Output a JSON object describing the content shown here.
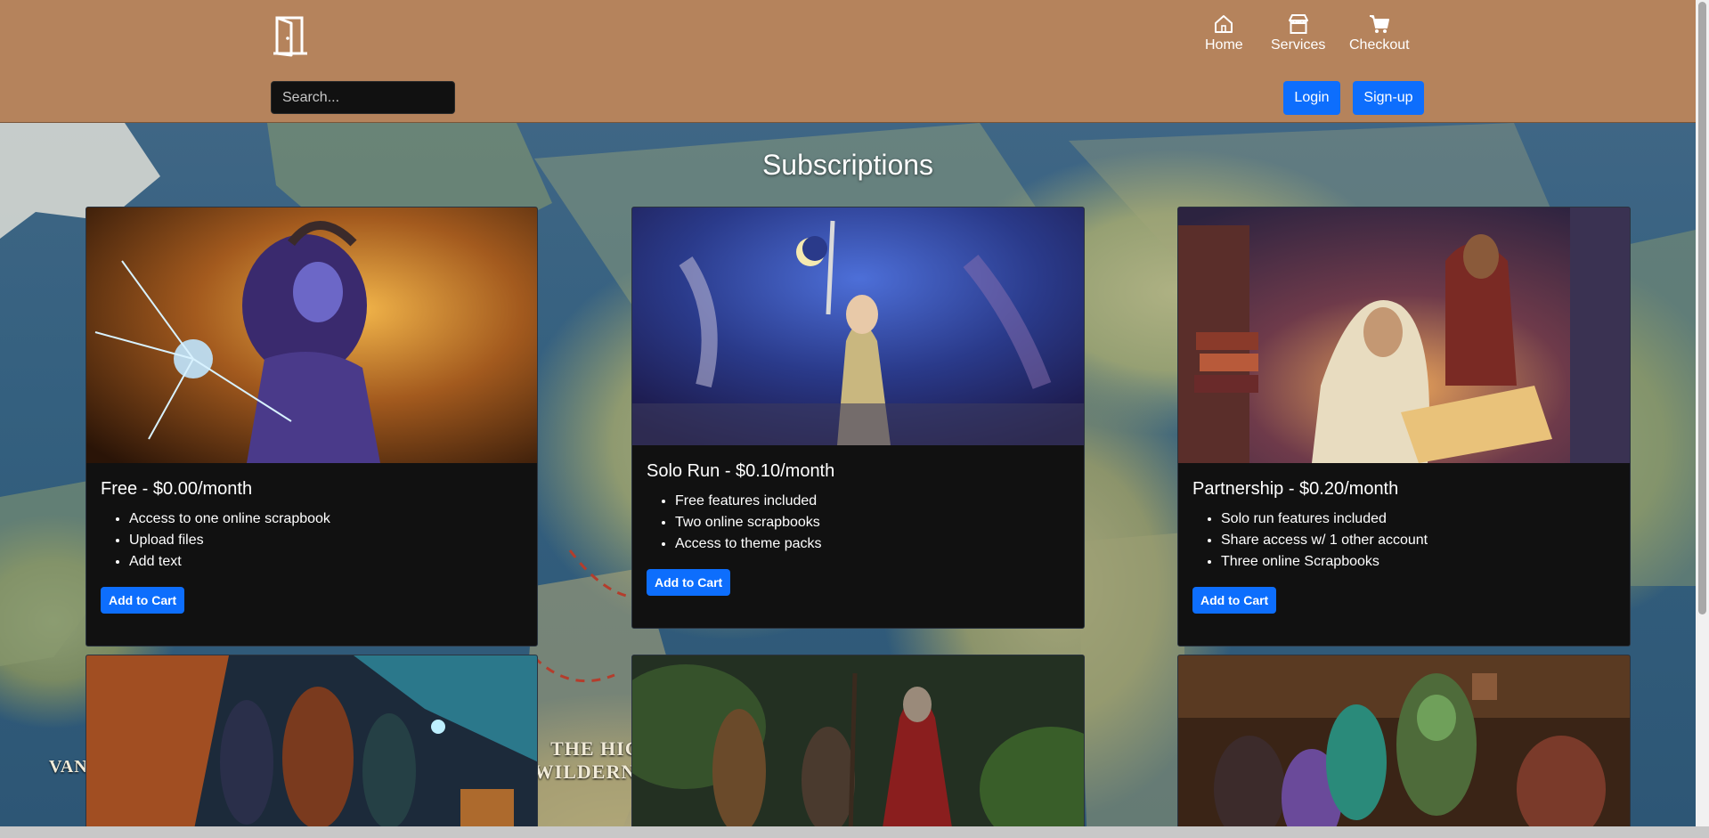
{
  "header": {
    "nav": {
      "home_label": "Home",
      "services_label": "Services",
      "checkout_label": "Checkout"
    },
    "search": {
      "placeholder": "Search..."
    },
    "login_label": "Login",
    "signup_label": "Sign-up"
  },
  "map": {
    "labels": [
      "VANNLAND",
      "THE HIGH WILDERNESS"
    ]
  },
  "main": {
    "title": "Subscriptions",
    "cards": [
      {
        "title": "Free - $0.00/month",
        "features": [
          "Access to one online scrapbook",
          "Upload files",
          "Add text"
        ],
        "button": "Add to Cart"
      },
      {
        "title": "Solo Run - $0.10/month",
        "features": [
          "Free features included",
          "Two online scrapbooks",
          "Access to theme packs"
        ],
        "button": "Add to Cart"
      },
      {
        "title": "Partnership - $0.20/month",
        "features": [
          "Solo run features included",
          "Share access w/ 1 other account",
          "Three online Scrapbooks"
        ],
        "button": "Add to Cart"
      }
    ]
  },
  "colors": {
    "header_bg": "#b5835c",
    "card_bg": "#111111",
    "primary": "#0d6efd"
  }
}
